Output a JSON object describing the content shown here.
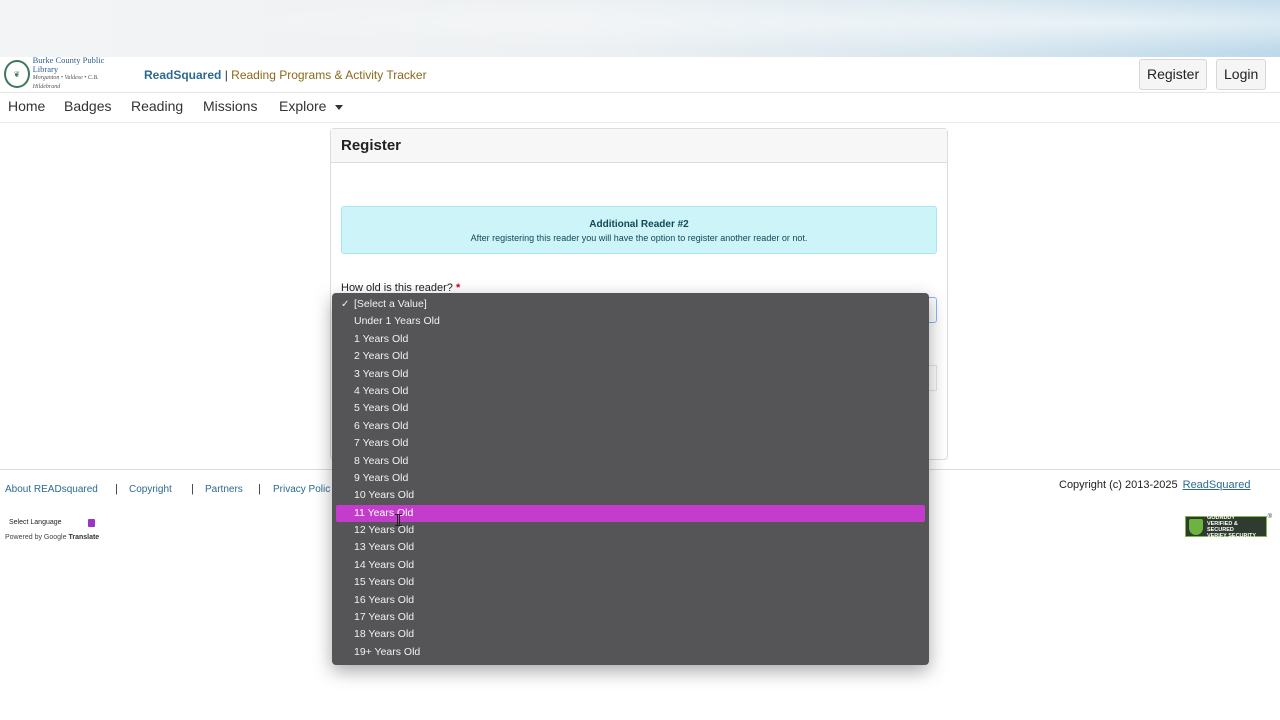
{
  "header": {
    "logo_line1": "Burke County Public Library",
    "logo_line2": "Morganton • Valdese • C.B. Hildebrand",
    "brand_name": "ReadSquared",
    "brand_sep": "|",
    "brand_tagline": "Reading Programs & Activity Tracker",
    "register_label": "Register",
    "login_label": "Login"
  },
  "nav": {
    "items": [
      "Home",
      "Badges",
      "Reading",
      "Missions",
      "Explore"
    ]
  },
  "card": {
    "title": "Register",
    "alert_title": "Additional Reader #2",
    "alert_text": "After registering this reader you will have the option to register another reader or not.",
    "question_label": "How old is this reader?",
    "required_mark": "*"
  },
  "dropdown": {
    "checkmark": "✓",
    "selected_index": 0,
    "highlighted_index": 12,
    "options": [
      "[Select a Value]",
      "Under 1 Years Old",
      "1 Years Old",
      "2 Years Old",
      "3 Years Old",
      "4 Years Old",
      "5 Years Old",
      "6 Years Old",
      "7 Years Old",
      "8 Years Old",
      "9 Years Old",
      "10 Years Old",
      "11 Years Old",
      "12 Years Old",
      "13 Years Old",
      "14 Years Old",
      "15 Years Old",
      "16 Years Old",
      "17 Years Old",
      "18 Years Old",
      "19+ Years Old"
    ],
    "highlight_color": "#c43ccb"
  },
  "footer": {
    "links": [
      "About READsquared",
      "Copyright",
      "Partners",
      "Privacy Polic"
    ],
    "separator": "|",
    "copyright_text": "Copyright (c) 2013-2025",
    "copyright_link": "ReadSquared",
    "language_select": "Select Language",
    "powered_prefix": "Powered by",
    "powered_google": "Google",
    "powered_translate": "Translate",
    "secured_line1": "GODADDY",
    "secured_line2": "VERIFIED & SECURED",
    "secured_line3": "VERIFY SECURITY"
  }
}
